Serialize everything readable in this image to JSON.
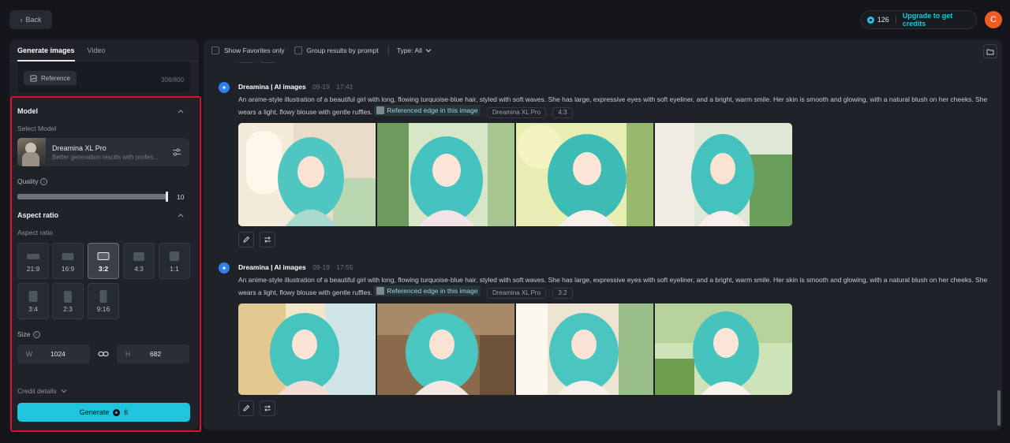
{
  "top": {
    "back_label": "Back",
    "credits_count": "126",
    "upgrade_label": "Upgrade to get credits",
    "avatar_letter": "C"
  },
  "left": {
    "tabs": [
      {
        "label": "Generate images",
        "active": true
      },
      {
        "label": "Video",
        "active": false
      }
    ],
    "reference_label": "Reference",
    "char_counter": "308/800",
    "model_section_title": "Model",
    "select_model_label": "Select Model",
    "model_name": "Dreamina XL Pro",
    "model_desc": "Better generation results with profes...",
    "quality_label": "Quality",
    "quality_value": "10",
    "quality_fraction": 1.0,
    "aspect_section_title": "Aspect ratio",
    "aspect_label": "Aspect ratio",
    "ratios": [
      {
        "label": "21:9",
        "active": false
      },
      {
        "label": "16:9",
        "active": false
      },
      {
        "label": "3:2",
        "active": true
      },
      {
        "label": "4:3",
        "active": false
      },
      {
        "label": "1:1",
        "active": false
      },
      {
        "label": "3:4",
        "active": false
      },
      {
        "label": "2:3",
        "active": false
      },
      {
        "label": "9:16",
        "active": false
      }
    ],
    "size_label": "Size",
    "width_prefix": "W",
    "width_value": "1024",
    "height_prefix": "H",
    "height_value": "682",
    "credit_details_label": "Credit details",
    "generate_label": "Generate",
    "generate_cost": "6"
  },
  "main": {
    "filters": {
      "favorites_label": "Show Favorites only",
      "group_label": "Group results by prompt",
      "type_label": "Type: All"
    },
    "results": [
      {
        "source": "Dreamina | AI images",
        "date": "09-19",
        "time": "17:41",
        "prompt": "An anime-style illustration of a beautiful girl with long, flowing turquoise-blue hair, styled with soft waves. She has large, expressive eyes with soft eyeliner, and a bright, warm smile. Her skin is smooth and glowing, with a natural blush on her cheeks. She wears a light, flowy blouse with gentle ruffles.",
        "ref_chip": "Referenced edge in this image",
        "model_tag": "Dreamina XL Pro",
        "ratio_tag": "4:3"
      },
      {
        "source": "Dreamina | AI images",
        "date": "09-19",
        "time": "17:55",
        "prompt": "An anime-style illustration of a beautiful girl with long, flowing turquoise-blue hair, styled with soft waves. She has large, expressive eyes with soft eyeliner, and a bright, warm smile. Her skin is smooth and glowing, with a natural blush on her cheeks. She wears a light, flowy blouse with gentle ruffles.",
        "ref_chip": "Referenced edge in this image",
        "model_tag": "Dreamina XL Pro",
        "ratio_tag": "3:2"
      }
    ]
  },
  "colors": {
    "accent": "#1fc5df",
    "highlight_frame": "#e0102a",
    "avatar": "#f05a24"
  }
}
